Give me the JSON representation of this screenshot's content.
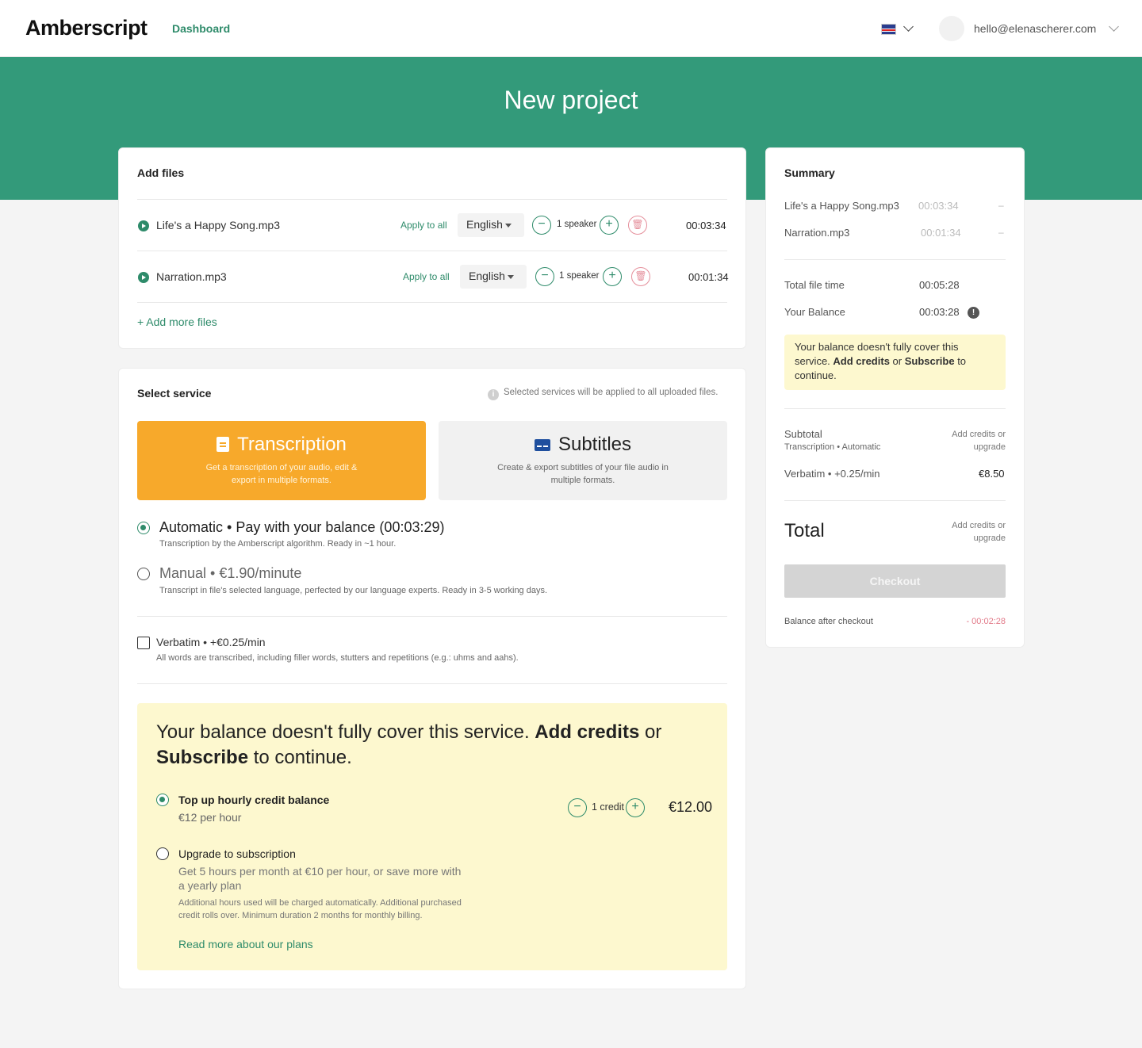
{
  "header": {
    "logo": "Amberscript",
    "nav_dashboard": "Dashboard",
    "email": "hello@elenascherer.com"
  },
  "page": {
    "title": "New project"
  },
  "add_files": {
    "title": "Add files",
    "files": [
      {
        "name": "Life's a Happy Song.mp3",
        "apply": "Apply to all",
        "language": "English",
        "speakers": "1 speaker",
        "duration": "00:03:34"
      },
      {
        "name": "Narration.mp3",
        "apply": "Apply to all",
        "language": "English",
        "speakers": "1 speaker",
        "duration": "00:01:34"
      }
    ],
    "add_more": "+ Add more files"
  },
  "select_service": {
    "title": "Select service",
    "note": "Selected services will be applied to all uploaded files.",
    "services": [
      {
        "title": "Transcription",
        "desc": "Get a transcription of your audio, edit & export in multiple formats."
      },
      {
        "title": "Subtitles",
        "desc": "Create & export subtitles of your file audio in multiple formats."
      }
    ],
    "automatic_title": "Automatic • Pay with your balance (00:03:29)",
    "automatic_sub": "Transcription by the Amberscript algorithm. Ready in ~1 hour.",
    "manual_title": "Manual • €1.90/minute",
    "manual_sub": "Transcript in file's selected language, perfected by our language experts. Ready in 3-5 working days.",
    "verbatim_title": "Verbatim • +€0.25/min",
    "verbatim_sub": "All words are transcribed, including filler words, stutters and repetitions (e.g.: uhms and aahs)."
  },
  "warning": {
    "text_a": "Your balance doesn't fully cover this service. ",
    "bold_a": "Add credits",
    "text_b": " or ",
    "bold_b": "Subscribe",
    "text_c": " to continue.",
    "topup_title": "Top up hourly credit balance",
    "topup_sub": "€12 per hour",
    "credits": "1 credit",
    "price": "€12.00",
    "upgrade_title": "Upgrade to subscription",
    "upgrade_sub": "Get 5 hours per month at €10 per hour, or save more with a yearly plan",
    "upgrade_fine": "Additional hours used will be charged automatically. Additional purchased credit rolls over. Minimum duration 2 months for monthly billing.",
    "read_more": "Read more about our plans"
  },
  "summary": {
    "title": "Summary",
    "files": [
      {
        "name": "Life's a Happy Song.mp3",
        "duration": "00:03:34",
        "price": "–"
      },
      {
        "name": "Narration.mp3",
        "duration": "00:01:34",
        "price": "–"
      }
    ],
    "total_file_time_label": "Total file time",
    "total_file_time": "00:05:28",
    "balance_label": "Your Balance",
    "balance": "00:03:28",
    "warn_a": "Your balance doesn't fully cover this service. ",
    "warn_bold_a": "Add credits",
    "warn_b": " or ",
    "warn_bold_b": "Subscribe",
    "warn_c": " to continue.",
    "subtotal_label": "Subtotal",
    "subtotal_sub": "Transcription • Automatic",
    "subtotal_value": "Add credits or upgrade",
    "verbatim_label": "Verbatim • +0.25/min",
    "verbatim_price": "€8.50",
    "total_label": "Total",
    "total_value": "Add credits or upgrade",
    "checkout": "Checkout",
    "after_label": "Balance after checkout",
    "after_value": "- 00:02:28"
  },
  "colors": {
    "brand_green": "#339a7a",
    "accent_orange": "#f7a92b",
    "warning_bg": "#fdf8cf"
  }
}
